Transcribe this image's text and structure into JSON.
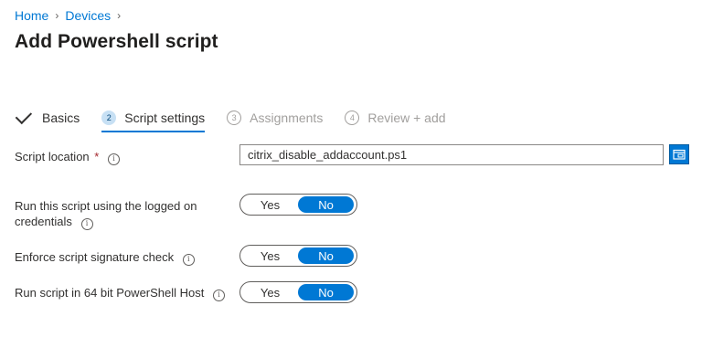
{
  "breadcrumb": {
    "home": "Home",
    "sep": "›",
    "devices": "Devices"
  },
  "page_title": "Add Powershell script",
  "steps": [
    {
      "number": "✓",
      "label": "Basics",
      "state": "done"
    },
    {
      "number": "2",
      "label": "Script settings",
      "state": "active"
    },
    {
      "number": "3",
      "label": "Assignments",
      "state": "pending"
    },
    {
      "number": "4",
      "label": "Review + add",
      "state": "pending"
    }
  ],
  "form": {
    "script_location": {
      "label": "Script location",
      "required_mark": "*",
      "value": "citrix_disable_addaccount.ps1"
    },
    "run_as_logged_on": {
      "label": "Run this script using the logged on credentials",
      "yes": "Yes",
      "no": "No",
      "selected": "No"
    },
    "signature_check": {
      "label": "Enforce script signature check",
      "yes": "Yes",
      "no": "No",
      "selected": "No"
    },
    "run_64bit": {
      "label": "Run script in 64 bit PowerShell Host",
      "yes": "Yes",
      "no": "No",
      "selected": "No"
    }
  },
  "info_glyph": "i",
  "colors": {
    "accent": "#0078d4",
    "required": "#a4262c",
    "disabled": "#a19f9d"
  }
}
